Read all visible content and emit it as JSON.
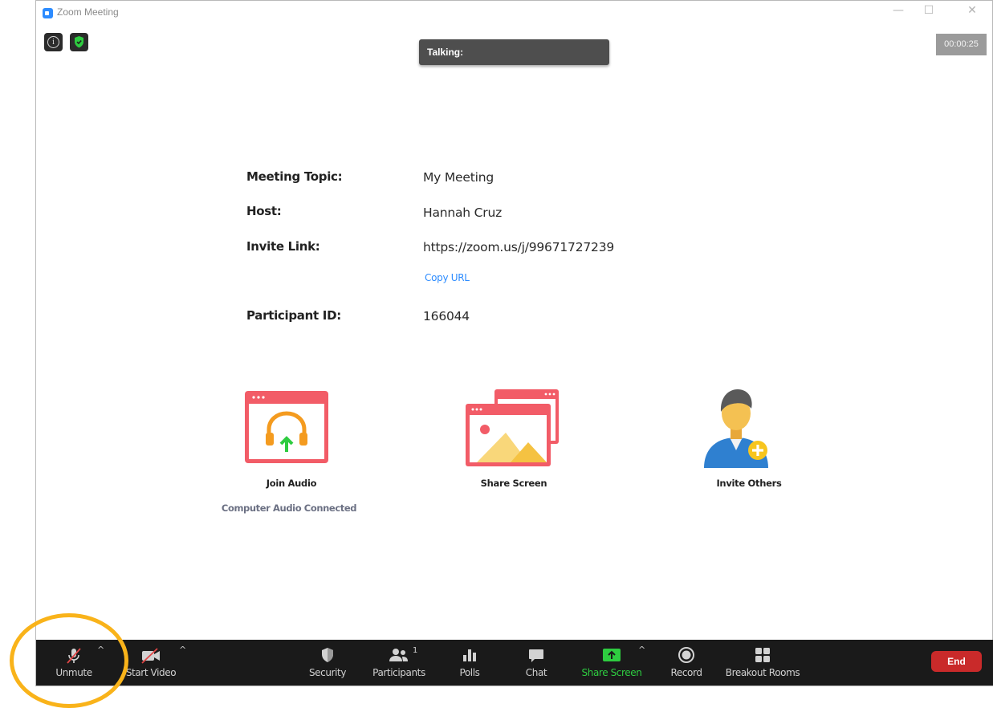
{
  "window": {
    "title": "Zoom Meeting",
    "controls": {
      "minimize": "—",
      "maximize": "☐",
      "close": "✕"
    }
  },
  "top_overlay": {
    "talking_label": "Talking:",
    "timer": "00:00:25",
    "info_icon": "info-icon",
    "security_icon": "shield-check-icon"
  },
  "meeting_info": {
    "rows": [
      {
        "label": "Meeting Topic:",
        "value": "My Meeting"
      },
      {
        "label": "Host:",
        "value": "Hannah Cruz"
      },
      {
        "label": "Invite Link:",
        "value": "https://zoom.us/j/99671727239"
      },
      {
        "label": "Participant ID:",
        "value": "166044"
      }
    ],
    "copy_url": "Copy URL"
  },
  "actions": {
    "join_audio": {
      "label": "Join Audio",
      "status": "Computer Audio Connected",
      "icon": "join-audio-icon"
    },
    "share_screen": {
      "label": "Share Screen",
      "icon": "share-screen-icon"
    },
    "invite_others": {
      "label": "Invite Others",
      "icon": "invite-user-icon"
    }
  },
  "toolbar": {
    "unmute": "Unmute",
    "start_video": "Start Video",
    "security": "Security",
    "participants": "Participants",
    "participants_count": "1",
    "polls": "Polls",
    "chat": "Chat",
    "share_screen": "Share Screen",
    "record": "Record",
    "breakout_rooms": "Breakout Rooms",
    "end": "End",
    "caret": "^"
  },
  "colors": {
    "accent_blue": "#2d8cff",
    "share_green": "#2ecc40",
    "end_red": "#c92a2a",
    "icon_red": "#f25c67",
    "highlight_orange": "#f9b31a",
    "toolbar_bg": "#1a1a1a"
  }
}
